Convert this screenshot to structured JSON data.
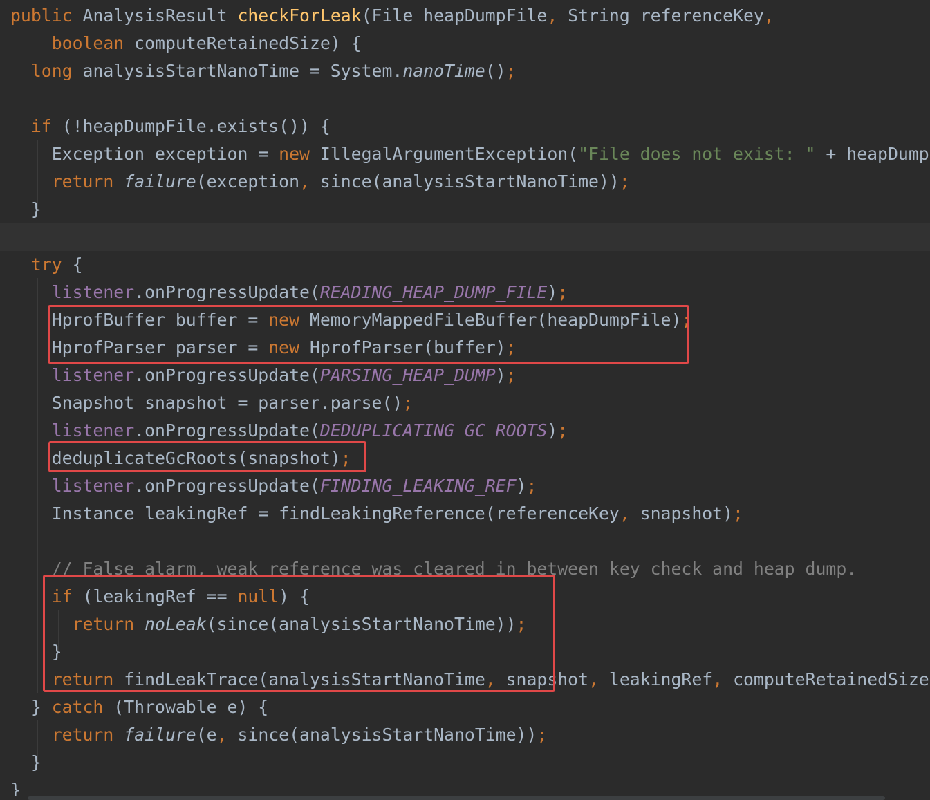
{
  "editor": {
    "colors": {
      "background": "#2b2b2b",
      "current_line": "#323232",
      "plain": "#a9b7c6",
      "keyword": "#cc7832",
      "method_declaration": "#ffc66d",
      "string": "#6a8759",
      "field": "#9876aa",
      "comment": "#808080",
      "highlight_box": "#e04848"
    },
    "current_line": 8,
    "lines": [
      [
        [
          "kw",
          "public "
        ],
        [
          "p",
          "AnalysisResult "
        ],
        [
          "fn",
          "checkForLeak"
        ],
        [
          "p",
          "(File heapDumpFile"
        ],
        [
          "kw",
          ", "
        ],
        [
          "p",
          "String referenceKey"
        ],
        [
          "kw",
          ","
        ]
      ],
      [
        [
          "p",
          "    "
        ],
        [
          "kw",
          "boolean "
        ],
        [
          "p",
          "computeRetainedSize) {"
        ]
      ],
      [
        [
          "p",
          "  "
        ],
        [
          "kw",
          "long "
        ],
        [
          "p",
          "analysisStartNanoTime = System."
        ],
        [
          "it",
          "nanoTime"
        ],
        [
          "p",
          "()"
        ],
        [
          "kw",
          ";"
        ]
      ],
      [],
      [
        [
          "p",
          "  "
        ],
        [
          "kw",
          "if "
        ],
        [
          "p",
          "(!heapDumpFile.exists()) {"
        ]
      ],
      [
        [
          "p",
          "    Exception exception = "
        ],
        [
          "kw",
          "new "
        ],
        [
          "p",
          "IllegalArgumentException("
        ],
        [
          "str",
          "\"File does not exist: \" "
        ],
        [
          "p",
          "+ heapDumpFile)"
        ],
        [
          "kw",
          ";"
        ]
      ],
      [
        [
          "p",
          "    "
        ],
        [
          "kw",
          "return "
        ],
        [
          "it",
          "failure"
        ],
        [
          "p",
          "(exception"
        ],
        [
          "kw",
          ", "
        ],
        [
          "p",
          "since(analysisStartNanoTime))"
        ],
        [
          "kw",
          ";"
        ]
      ],
      [
        [
          "p",
          "  }"
        ]
      ],
      [],
      [
        [
          "p",
          "  "
        ],
        [
          "kw",
          "try "
        ],
        [
          "p",
          "{"
        ]
      ],
      [
        [
          "p",
          "    "
        ],
        [
          "fld",
          "listener"
        ],
        [
          "p",
          ".onProgressUpdate("
        ],
        [
          "sfld",
          "READING_HEAP_DUMP_FILE"
        ],
        [
          "p",
          ")"
        ],
        [
          "kw",
          ";"
        ]
      ],
      [
        [
          "p",
          "    HprofBuffer buffer = "
        ],
        [
          "kw",
          "new "
        ],
        [
          "p",
          "MemoryMappedFileBuffer(heapDumpFile)"
        ],
        [
          "kw",
          ";"
        ]
      ],
      [
        [
          "p",
          "    HprofParser parser = "
        ],
        [
          "kw",
          "new "
        ],
        [
          "p",
          "HprofParser(buffer)"
        ],
        [
          "kw",
          ";"
        ]
      ],
      [
        [
          "p",
          "    "
        ],
        [
          "fld",
          "listener"
        ],
        [
          "p",
          ".onProgressUpdate("
        ],
        [
          "sfld",
          "PARSING_HEAP_DUMP"
        ],
        [
          "p",
          ")"
        ],
        [
          "kw",
          ";"
        ]
      ],
      [
        [
          "p",
          "    Snapshot snapshot = parser.parse()"
        ],
        [
          "kw",
          ";"
        ]
      ],
      [
        [
          "p",
          "    "
        ],
        [
          "fld",
          "listener"
        ],
        [
          "p",
          ".onProgressUpdate("
        ],
        [
          "sfld",
          "DEDUPLICATING_GC_ROOTS"
        ],
        [
          "p",
          ")"
        ],
        [
          "kw",
          ";"
        ]
      ],
      [
        [
          "p",
          "    deduplicateGcRoots(snapshot)"
        ],
        [
          "kw",
          ";"
        ]
      ],
      [
        [
          "p",
          "    "
        ],
        [
          "fld",
          "listener"
        ],
        [
          "p",
          ".onProgressUpdate("
        ],
        [
          "sfld",
          "FINDING_LEAKING_REF"
        ],
        [
          "p",
          ")"
        ],
        [
          "kw",
          ";"
        ]
      ],
      [
        [
          "p",
          "    Instance leakingRef = findLeakingReference(referenceKey"
        ],
        [
          "kw",
          ", "
        ],
        [
          "p",
          "snapshot)"
        ],
        [
          "kw",
          ";"
        ]
      ],
      [],
      [
        [
          "p",
          "    "
        ],
        [
          "cm",
          "// False alarm, weak reference was cleared in between key check and heap dump."
        ]
      ],
      [
        [
          "p",
          "    "
        ],
        [
          "kw",
          "if "
        ],
        [
          "p",
          "(leakingRef == "
        ],
        [
          "kw",
          "null"
        ],
        [
          "p",
          ") {"
        ]
      ],
      [
        [
          "p",
          "      "
        ],
        [
          "kw",
          "return "
        ],
        [
          "it",
          "noLeak"
        ],
        [
          "p",
          "(since(analysisStartNanoTime))"
        ],
        [
          "kw",
          ";"
        ]
      ],
      [
        [
          "p",
          "    }"
        ]
      ],
      [
        [
          "p",
          "    "
        ],
        [
          "kw",
          "return "
        ],
        [
          "p",
          "findLeakTrace(analysisStartNanoTime"
        ],
        [
          "kw",
          ", "
        ],
        [
          "p",
          "snapshot"
        ],
        [
          "kw",
          ", "
        ],
        [
          "p",
          "leakingRef"
        ],
        [
          "kw",
          ", "
        ],
        [
          "p",
          "computeRetainedSize)"
        ],
        [
          "kw",
          ";"
        ]
      ],
      [
        [
          "p",
          "  } "
        ],
        [
          "kw",
          "catch "
        ],
        [
          "p",
          "(Throwable e) {"
        ]
      ],
      [
        [
          "p",
          "    "
        ],
        [
          "kw",
          "return "
        ],
        [
          "it",
          "failure"
        ],
        [
          "p",
          "(e"
        ],
        [
          "kw",
          ", "
        ],
        [
          "p",
          "since(analysisStartNanoTime))"
        ],
        [
          "kw",
          ";"
        ]
      ],
      [
        [
          "p",
          "  }"
        ]
      ],
      [
        [
          "p",
          "}"
        ]
      ]
    ]
  }
}
